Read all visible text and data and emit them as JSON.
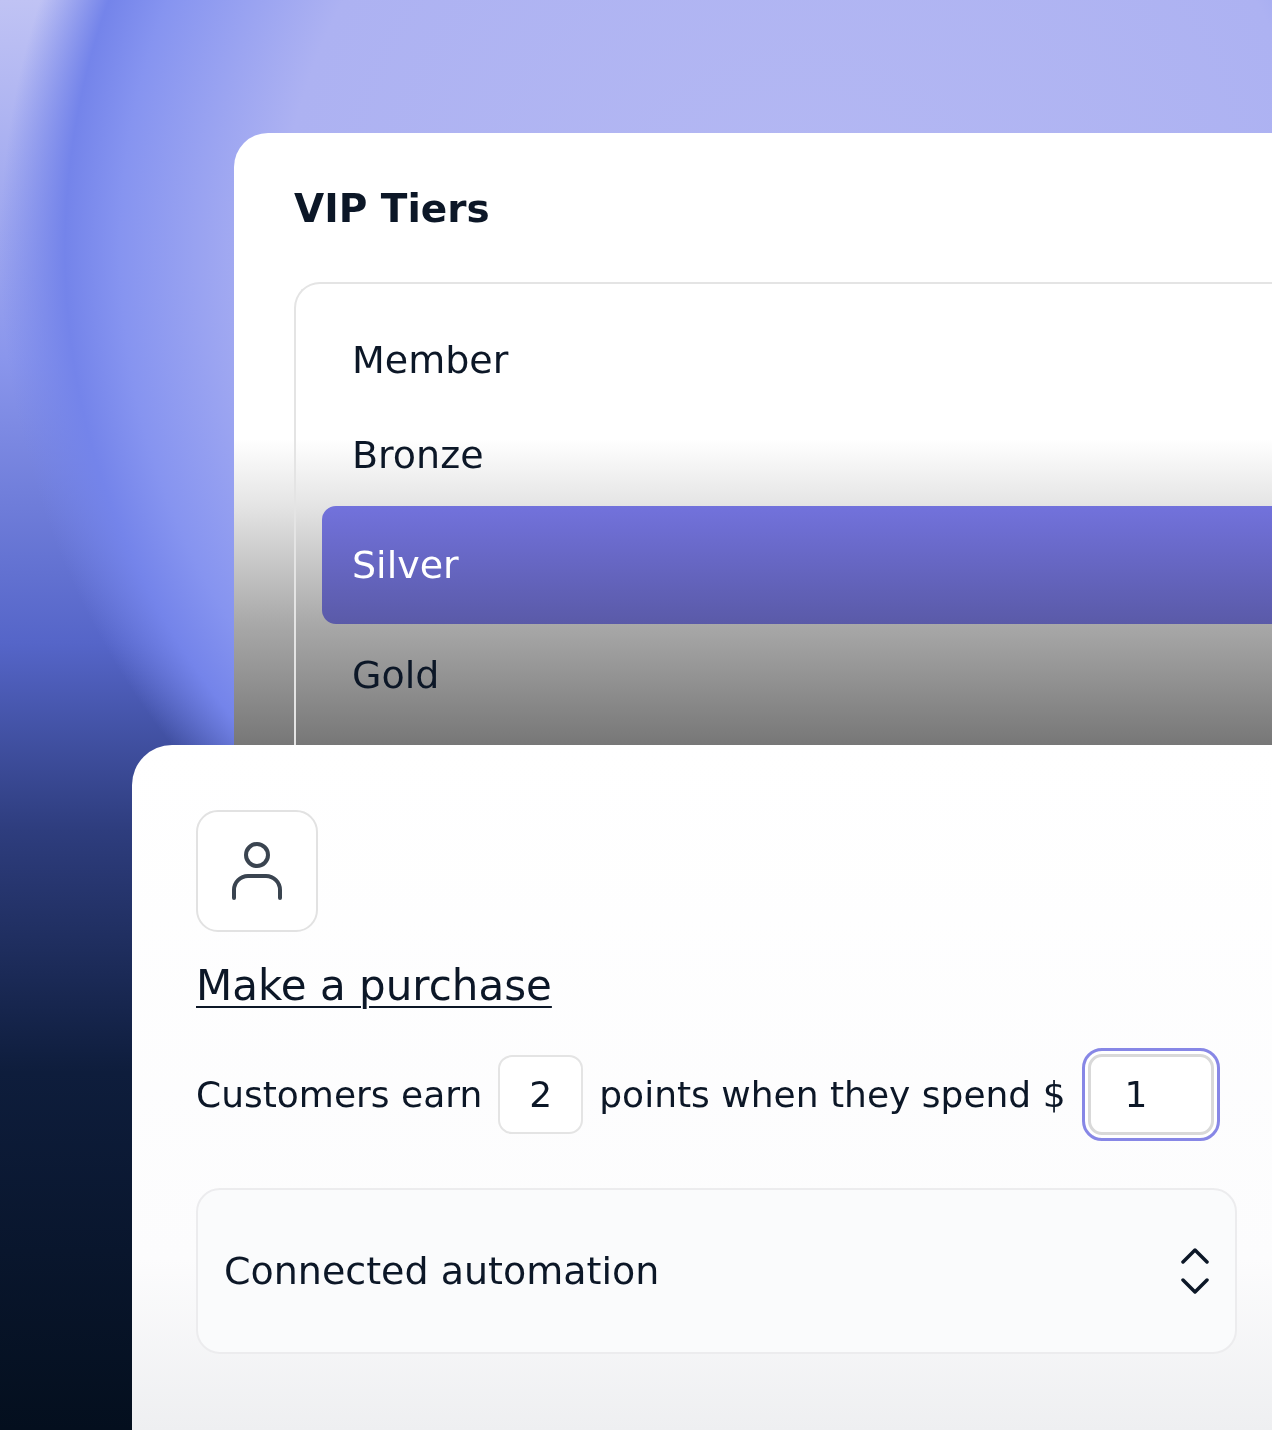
{
  "tiers_panel": {
    "title": "VIP Tiers",
    "tiers": [
      {
        "label": "Member",
        "selected": false
      },
      {
        "label": "Bronze",
        "selected": false
      },
      {
        "label": "Silver",
        "selected": true
      },
      {
        "label": "Gold",
        "selected": false
      }
    ]
  },
  "rule_card": {
    "title": "Make a purchase",
    "sentence": [
      {
        "kind": "text",
        "text": "Customers earn"
      },
      {
        "kind": "input",
        "value": "2",
        "focused": false
      },
      {
        "kind": "text",
        "text": "points when they spend $"
      },
      {
        "kind": "input",
        "value": "1",
        "focused": true
      }
    ],
    "automation_select": {
      "value": "Connected automation"
    }
  }
}
